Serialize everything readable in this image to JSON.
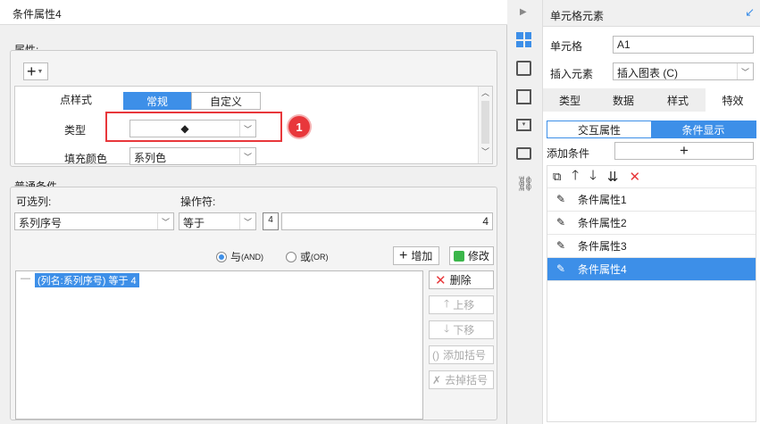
{
  "dialog": {
    "title": "条件属性4",
    "properties": {
      "legend": "属性:",
      "add_symbol": "+",
      "point_style_label": "点样式",
      "point_style_options": [
        "常规",
        "自定义"
      ],
      "type_label": "类型",
      "type_value": "◆",
      "fill_color_label": "填充颜色",
      "fill_color_value": "系列色",
      "callout_number": "1"
    },
    "conditions": {
      "legend": "普通条件",
      "optional_column_label": "可选列:",
      "optional_column_value": "系列序号",
      "operator_label": "操作符:",
      "operator_value": "等于",
      "type_badge": "4",
      "value": "4",
      "and_label": "与",
      "and_sub": "(AND)",
      "or_label": "或",
      "or_sub": "(OR)",
      "add_label": "增加",
      "modify_label": "修改",
      "condition_text": "(列名:系列序号) 等于 4",
      "delete_label": "删除",
      "move_up_label": "上移",
      "move_down_label": "下移",
      "add_bracket_label": "添加括号",
      "remove_bracket_label": "去掉括号"
    }
  },
  "panel": {
    "title": "单元格元素",
    "cell_label": "单元格",
    "cell_value": "A1",
    "insert_label": "插入元素",
    "insert_value": "插入图表 (C)",
    "tabs": [
      "类型",
      "数据",
      "样式",
      "特效"
    ],
    "subtabs": [
      "交互属性",
      "条件显示"
    ],
    "add_condition_label": "添加条件",
    "add_symbol": "+",
    "conditions": [
      "条件属性1",
      "条件属性2",
      "条件属性3",
      "条件属性4"
    ]
  },
  "colors": {
    "accent": "#3d8fe8",
    "callout": "#e8373b",
    "delete_red": "#e8373b"
  }
}
